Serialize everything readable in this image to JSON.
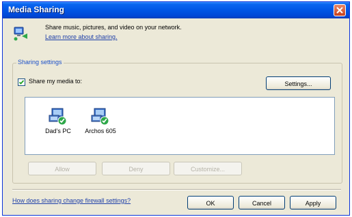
{
  "window": {
    "title": "Media Sharing"
  },
  "header": {
    "description": "Share music, pictures, and video on your network.",
    "learn_more": "Learn more about sharing."
  },
  "sharing_settings": {
    "group_title": "Sharing settings",
    "share_checkbox_label": "Share my media to:",
    "share_checked": true,
    "settings_button": "Settings...",
    "devices": [
      {
        "name": "Dad's PC",
        "icon": "networked-computer-icon"
      },
      {
        "name": "Archos 605",
        "icon": "networked-device-icon"
      }
    ],
    "allow_button": "Allow",
    "deny_button": "Deny",
    "customize_button": "Customize..."
  },
  "footer": {
    "help_link": "How does sharing change firewall settings?",
    "ok_button": "OK",
    "cancel_button": "Cancel",
    "apply_button": "Apply"
  }
}
